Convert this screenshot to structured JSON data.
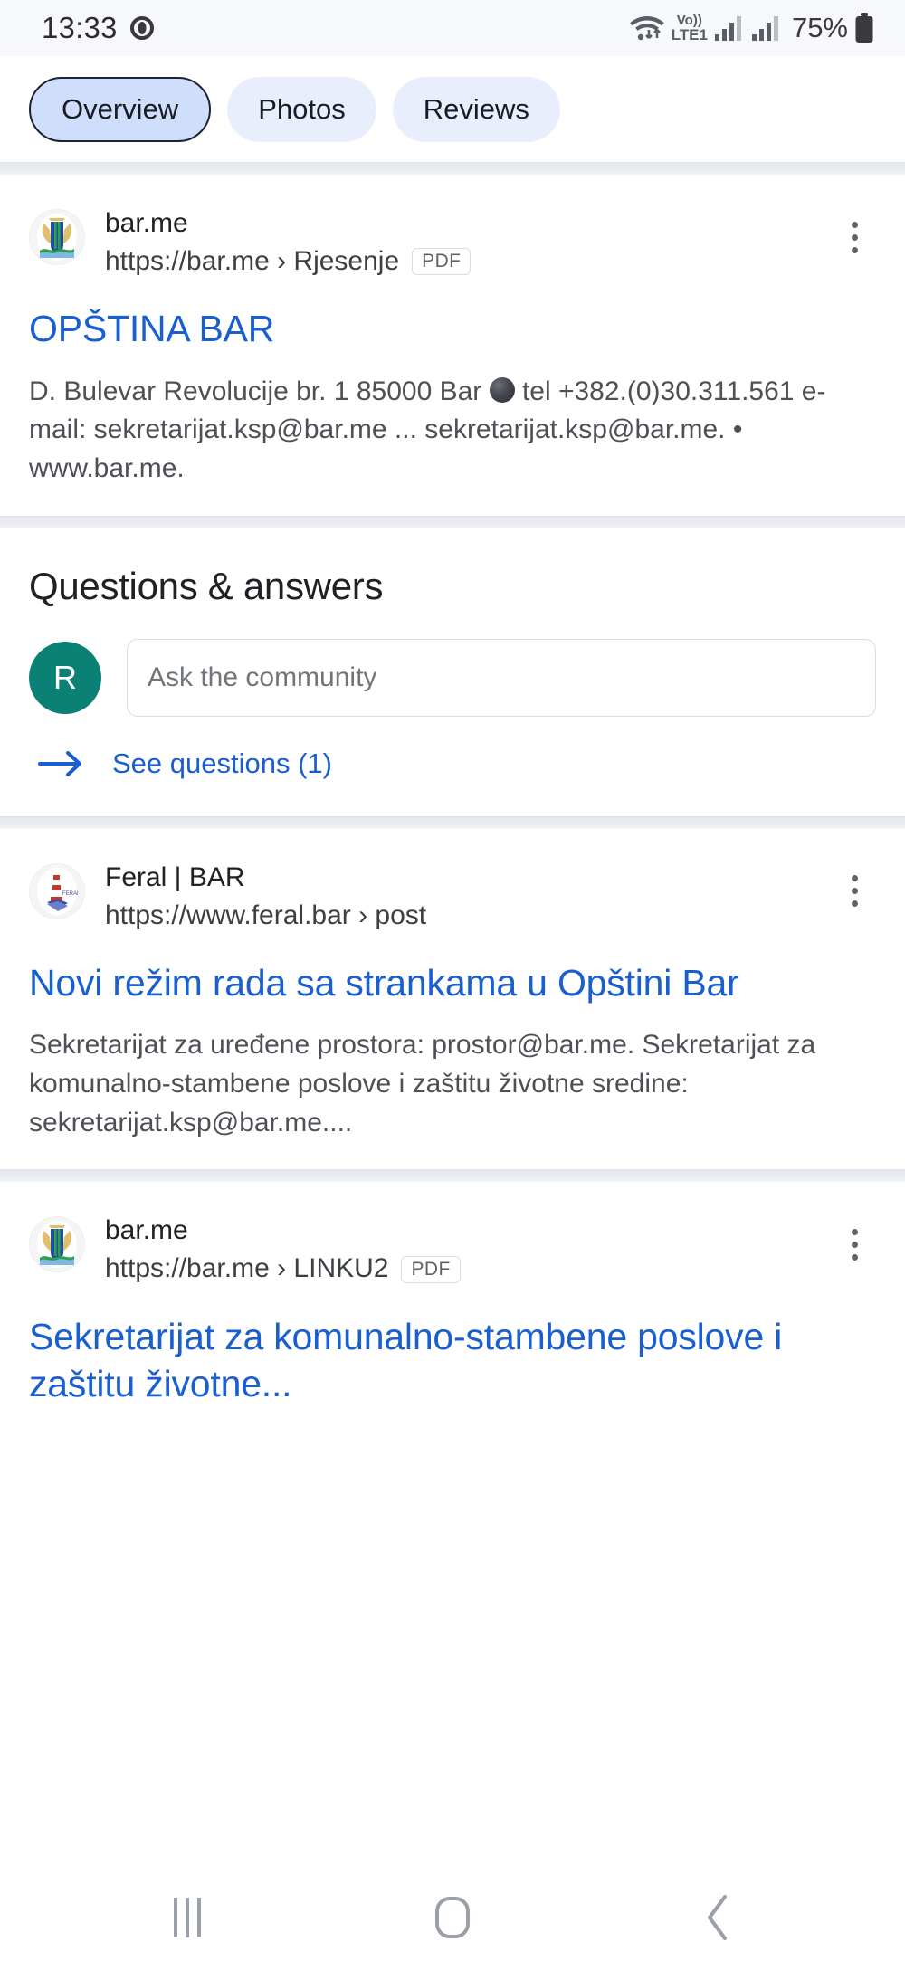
{
  "statusbar": {
    "time": "13:33",
    "battery_percent": "75%",
    "network_label": "LTE1",
    "volte_label": "Vo))",
    "icons": [
      "screen-record-icon",
      "wifi-icon",
      "volte-icon",
      "signal-icon-1",
      "signal-icon-2",
      "battery-icon"
    ]
  },
  "tabs": [
    {
      "label": "Overview",
      "selected": true
    },
    {
      "label": "Photos",
      "selected": false
    },
    {
      "label": "Reviews",
      "selected": false
    }
  ],
  "results": [
    {
      "site_name": "bar.me",
      "url": "https://bar.me › Rjesenje",
      "badge": "PDF",
      "favicon": "coat-of-arms-icon",
      "title": "OPŠTINA BAR",
      "snippet_before": "D. Bulevar Revolucije br. 1 85000 Bar ",
      "snippet_after": " tel +382.(0)30.311.561 e-mail: sekretarijat.ksp@bar.me ... sekretarijat.ksp@bar.me. • www.bar.me."
    },
    {
      "site_name": "Feral | BAR",
      "url": "https://www.feral.bar › post",
      "badge": "",
      "favicon": "lighthouse-icon",
      "title": "Novi režim rada sa strankama u Opštini Bar",
      "snippet_before": "Sekretarijat za uređene prostora: prostor@bar.me. Sekretarijat za komunalno-stambene poslove i zaštitu životne sredine: sekretarijat.ksp@bar.me....",
      "snippet_after": ""
    },
    {
      "site_name": "bar.me",
      "url": "https://bar.me › LINKU2",
      "badge": "PDF",
      "favicon": "coat-of-arms-icon",
      "title": "Sekretarijat za komunalno-stambene poslove i zaštitu životne...",
      "snippet_before": "",
      "snippet_after": ""
    }
  ],
  "qa": {
    "heading": "Questions & answers",
    "avatar_initial": "R",
    "ask_placeholder": "Ask the community",
    "see_questions_label": "See questions (1)"
  },
  "navbar": {
    "recents": "recents-icon",
    "home": "home-icon",
    "back": "back-icon"
  },
  "colors": {
    "link_blue": "#1a5fd0",
    "chip_selected": "#cfdffb",
    "chip_default": "#e8eefc",
    "avatar_teal": "#0b8175",
    "snippet_gray": "#4d5156"
  }
}
